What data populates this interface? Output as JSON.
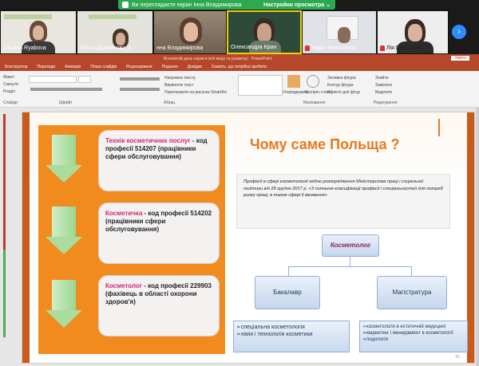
{
  "zoom": {
    "banner_text": "Ви переглядаєте екран Інна Владимирова",
    "view_options": "Настройки просмотра",
    "participants": [
      {
        "name": "Oksana Ryabova",
        "muted": false
      },
      {
        "name": "Ольга Должикова_к...",
        "muted": false
      },
      {
        "name": "нна Владимирова",
        "muted": false
      },
      {
        "name": "Олександра Кран",
        "muted": false
      },
      {
        "name": "Надія Кононенко",
        "muted": true
      },
      {
        "name": "Лія Перехода",
        "muted": true
      }
    ],
    "next_icon": "chevron-right-icon",
    "accent_color": "#2d8cff",
    "share_color": "#2da94f"
  },
  "ppt": {
    "window_title": "Всесвітній день науки в ім'я миру та розвитку  -  PowerPoint",
    "sign_in": "Увійти",
    "tabs": [
      "Конструктор",
      "Переходи",
      "Анімація",
      "Показ слайдів",
      "Рецензування",
      "Подання",
      "Довідка",
      "Скажіть, що потрібно зробити"
    ],
    "ribbon": {
      "paste_items": [
        "Макет",
        "Скинути",
        "Розділ"
      ],
      "clipboard_label": "Слайди",
      "font_label": "Шрифт",
      "paragraph_label": "Абзац",
      "drawing_label": "Малювання",
      "editing_label": "Редагування",
      "text_direction": "Напрямок тексту",
      "align_text": "Вирівняти текст",
      "smartart": "Перетворити на рисунок SmartArt",
      "arrange": "Упорядкувати",
      "quick_styles": "Експрес-стилі",
      "fill": "Заливка фігури",
      "outline": "Контур фігури",
      "effects": "Ефекти для фігур",
      "find": "Знайти",
      "replace": "Замінити",
      "select": "Виділити"
    },
    "brand_color": "#b7472a"
  },
  "slide": {
    "title": "Чому саме Польща ?",
    "cards": [
      {
        "keyword": "Технік косметичних послуг",
        "rest": " - код професії  514207 (працівники сфери обслуговування)"
      },
      {
        "keyword": "Косметичка",
        "rest": " - код професії 514202 (працівники сфери обслуговування)"
      },
      {
        "keyword": "Косметолог",
        "rest": " - код професії 229903 (фахівець в області охорони здоров'я)"
      }
    ],
    "description": "Професії в сфері косметології згідно розпорядження Міністерства праці і соціальної політики від 28 грудня 2017 р. «З питання класифікації професії і спеціальностей для потреб ринку праці, в також сфері її вживання»",
    "diagram": {
      "root": "Косметолог",
      "branches": [
        {
          "label": "Бакалавр",
          "items": [
            "➢спеціальна косметологія",
            "➢хімія і технологія косметики"
          ]
        },
        {
          "label": "Магістратура",
          "items": [
            "➢косметологія в естетичній медицині",
            "➢маркетинг і менеджмент в косметології",
            "➢подологія"
          ]
        }
      ]
    },
    "slide_number": "55"
  }
}
